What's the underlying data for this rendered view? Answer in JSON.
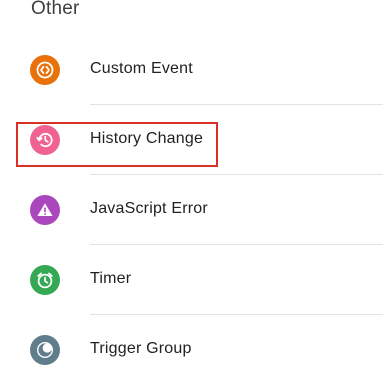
{
  "section": {
    "title": "Other"
  },
  "items": [
    {
      "label": "Custom Event",
      "icon": "code-brackets-icon",
      "color": "#e8710a"
    },
    {
      "label": "History Change",
      "icon": "history-icon",
      "color": "#f06292"
    },
    {
      "label": "JavaScript Error",
      "icon": "warning-icon",
      "color": "#ab47bc"
    },
    {
      "label": "Timer",
      "icon": "alarm-clock-icon",
      "color": "#34a853"
    },
    {
      "label": "Trigger Group",
      "icon": "trigger-group-icon",
      "color": "#607d8b"
    }
  ],
  "highlight": {
    "target": "History Change",
    "color": "#d93025"
  }
}
